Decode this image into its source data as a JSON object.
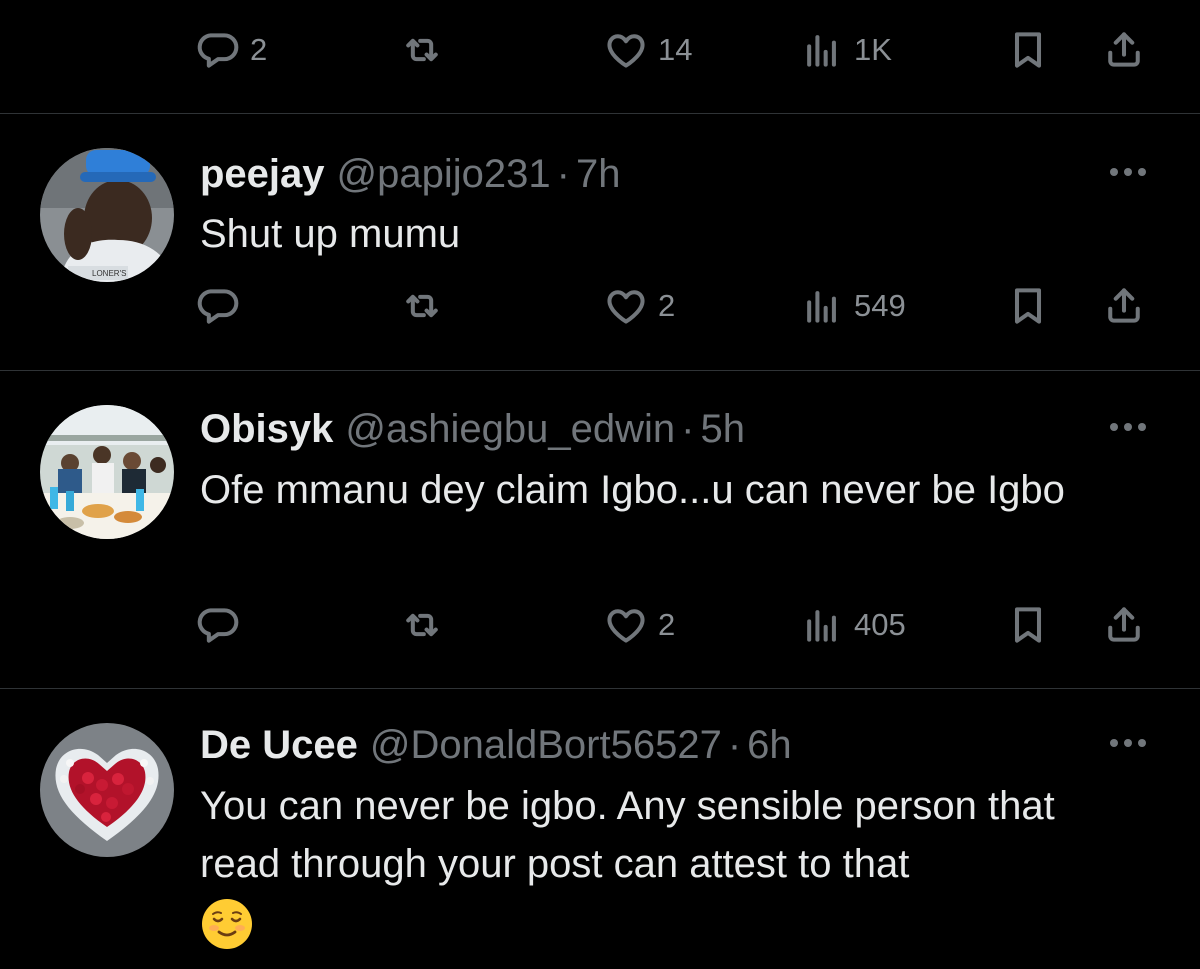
{
  "top_actions": {
    "replies": "2",
    "retweets": "",
    "likes": "14",
    "views": "1K"
  },
  "tweets": [
    {
      "name": "peejay",
      "handle": "@papijo231",
      "separator": "·",
      "time": "7h",
      "text": "Shut up mumu",
      "avatar_text": "LONER'S",
      "actions": {
        "replies": "",
        "retweets": "",
        "likes": "2",
        "views": "549"
      }
    },
    {
      "name": "Obisyk",
      "handle": "@ashiegbu_edwin",
      "separator": "·",
      "time": "5h",
      "text": "Ofe mmanu dey claim Igbo...u can never be Igbo",
      "actions": {
        "replies": "",
        "retweets": "",
        "likes": "2",
        "views": "405"
      }
    },
    {
      "name": "De Ucee",
      "handle": "@DonaldBort56527",
      "separator": "·",
      "time": "6h",
      "text": "You can never be igbo. Any sensible person that read through your post can attest to that",
      "emoji": "relieved-face-emoji"
    }
  ],
  "colors": {
    "background": "#000000",
    "text_primary": "#e7e9ea",
    "text_secondary": "#71767b",
    "divider": "#2f3336"
  },
  "icons": [
    "reply-icon",
    "retweet-icon",
    "like-icon",
    "views-icon",
    "bookmark-icon",
    "share-icon",
    "more-icon"
  ]
}
